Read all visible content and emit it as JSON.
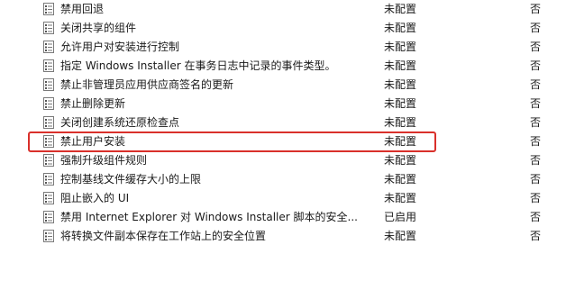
{
  "policy_list": {
    "rows": [
      {
        "name": "禁用回退",
        "state": "未配置",
        "comment": "否",
        "icon": "policy-setting-icon"
      },
      {
        "name": "关闭共享的组件",
        "state": "未配置",
        "comment": "否",
        "icon": "policy-setting-icon"
      },
      {
        "name": "允许用户对安装进行控制",
        "state": "未配置",
        "comment": "否",
        "icon": "policy-setting-icon"
      },
      {
        "name": "指定 Windows Installer 在事务日志中记录的事件类型。",
        "state": "未配置",
        "comment": "否",
        "icon": "policy-setting-icon"
      },
      {
        "name": "禁止非管理员应用供应商签名的更新",
        "state": "未配置",
        "comment": "否",
        "icon": "policy-setting-icon"
      },
      {
        "name": "禁止删除更新",
        "state": "未配置",
        "comment": "否",
        "icon": "policy-setting-icon"
      },
      {
        "name": "关闭创建系统还原检查点",
        "state": "未配置",
        "comment": "否",
        "icon": "policy-setting-icon"
      },
      {
        "name": "禁止用户安装",
        "state": "未配置",
        "comment": "否",
        "icon": "policy-setting-icon"
      },
      {
        "name": "强制升级组件规则",
        "state": "未配置",
        "comment": "否",
        "icon": "policy-setting-icon"
      },
      {
        "name": "控制基线文件缓存大小的上限",
        "state": "未配置",
        "comment": "否",
        "icon": "policy-setting-icon"
      },
      {
        "name": "阻止嵌入的 UI",
        "state": "未配置",
        "comment": "否",
        "icon": "policy-setting-icon"
      },
      {
        "name": "禁用 Internet Explorer 对 Windows Installer 脚本的安全...",
        "state": "已启用",
        "comment": "否",
        "icon": "policy-setting-icon"
      },
      {
        "name": "将转换文件副本保存在工作站上的安全位置",
        "state": "未配置",
        "comment": "否",
        "icon": "policy-setting-icon"
      }
    ],
    "highlighted_row_index": 7
  },
  "colors": {
    "highlight_border": "#d9302b",
    "text": "#1a1a1a",
    "background": "#ffffff"
  }
}
